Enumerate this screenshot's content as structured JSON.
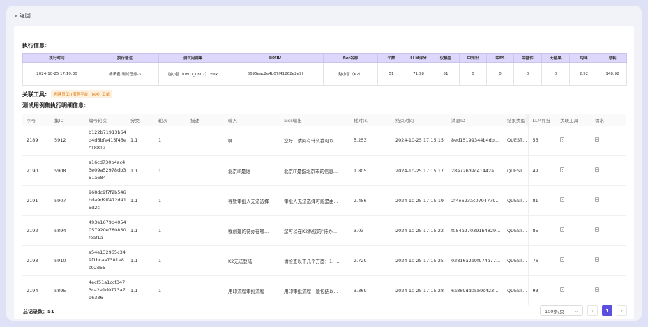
{
  "nav": {
    "back_label": "返回"
  },
  "exec_info": {
    "title": "执行信息:",
    "headers": [
      "执行时间",
      "执行备注",
      "测试用例集",
      "BotID",
      "Bot名称",
      "个数",
      "LLM评分",
      "仅模型",
      "中知识",
      "中ES",
      "中插件",
      "无结果",
      "均耗",
      "总耗"
    ],
    "values": [
      "2024-10-25 17:10:30",
      "杨潇君-测试任务-3",
      "赵小智（0801_0802）.xlsx",
      "6695eac2e4b07f41262e2e9f",
      "赵小智（K2）",
      "51",
      "71.98",
      "51",
      "0",
      "0",
      "0",
      "0",
      "2.92",
      "148.92"
    ]
  },
  "related_tools": {
    "label": "关联工具:",
    "tag": "创建员工IT服务平台（IRA）工单"
  },
  "detail": {
    "title": "测试用例集执行明细信息:",
    "headers": [
      "序号",
      "集ID",
      "编号轮次",
      "分类",
      "轮次",
      "描述",
      "输入",
      "aics输出",
      "耗时(s)",
      "结束时间",
      "消息ID",
      "结果类型",
      "LLM评分",
      "关联工具",
      "请求"
    ],
    "rows": [
      {
        "seq": "2189",
        "set_id": "5912",
        "code": "b122b71913b64d4d6bfe415f45ec18812",
        "category": "1.1",
        "round": "1",
        "desc": "",
        "input": "啊",
        "output": "您好，请问有什么我可以...",
        "time": "5.253",
        "end": "2024-10-25 17:15:15",
        "msg": "8ed15199344b4db...",
        "type": "QUESTION",
        "score": "55",
        "score_color": "red"
      },
      {
        "seq": "2190",
        "set_id": "5908",
        "code": "a16cd730b4ac43e09a52978db351a684",
        "category": "1.1",
        "round": "1",
        "desc": "",
        "input": "北京IT是谁",
        "output": "北京IT是指北京市的信息...",
        "time": "1.805",
        "end": "2024-10-25 17:15:17",
        "msg": "28a72bd9c41442a...",
        "type": "QUESTION",
        "score": "49",
        "score_color": "red"
      },
      {
        "seq": "2191",
        "set_id": "5907",
        "code": "968dc9f7f2b546bda9d9ff472d415d2c",
        "category": "1.1",
        "round": "1",
        "desc": "",
        "input": "导致审批人无法选择",
        "output": "审批人无法选择可能是由...",
        "time": "2.456",
        "end": "2024-10-25 17:15:19",
        "msg": "2f4e623ac0794779...",
        "type": "QUESTION",
        "score": "81",
        "score_color": "gray"
      },
      {
        "seq": "2192",
        "set_id": "5894",
        "code": "493e1679d4054057920e780830feaf1a",
        "category": "1.1",
        "round": "1",
        "desc": "",
        "input": "我创建的待办在哪...",
        "output": "您可以在K2系统的\"待办...",
        "time": "3.03",
        "end": "2024-10-25 17:15:22",
        "msg": "f054a270391b4829...",
        "type": "QUESTION",
        "score": "85",
        "score_color": "gray"
      },
      {
        "seq": "2193",
        "set_id": "5910",
        "code": "a54e132965c349f1bcaa7381e8c92d55",
        "category": "1.1",
        "round": "1",
        "desc": "",
        "input": "K2无法登陆",
        "output": "请检查以下几个方面：1. ...",
        "time": "2.729",
        "end": "2024-10-25 17:15:25",
        "msg": "02816a2b9f974a77...",
        "type": "QUESTION",
        "score": "76",
        "score_color": "orange"
      },
      {
        "seq": "2194",
        "set_id": "5895",
        "code": "4ecf51a1ccf3473ca2e1d0773a796336",
        "category": "1.1",
        "round": "1",
        "desc": "",
        "input": "用印流程审批流程",
        "output": "用印审批流程一般包括以...",
        "time": "3.369",
        "end": "2024-10-25 17:15:28",
        "msg": "6a889dd05b9c423...",
        "type": "QUESTION",
        "score": "93",
        "score_color": "gray"
      }
    ]
  },
  "footer": {
    "total_label": "总记录数：51",
    "page_size": "100条/页",
    "current_page": "1",
    "prev": "‹",
    "next": "›"
  },
  "colors": {
    "accent": "#5b4fe0",
    "header_bg": "#dcd7fb",
    "tag_text": "#e07b15",
    "score_red": "#e24b3b",
    "score_orange": "#e88a1a"
  },
  "icons": {
    "back": "double-chevron-left-icon",
    "doc": "document-icon",
    "dropdown": "chevron-down-icon"
  }
}
